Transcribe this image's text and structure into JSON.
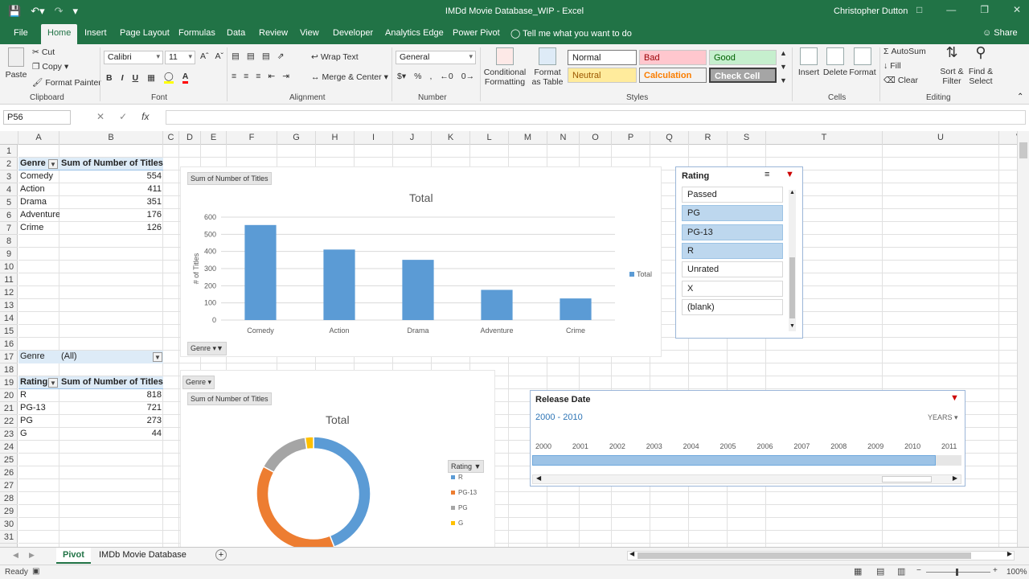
{
  "title": {
    "document": "IMDd Movie Database_WIP - Excel",
    "user": "Christopher Dutton"
  },
  "tabs": [
    "File",
    "Home",
    "Insert",
    "Page Layout",
    "Formulas",
    "Data",
    "Review",
    "View",
    "Developer",
    "Analytics Edge",
    "Power Pivot"
  ],
  "tell_me": "Tell me what you want to do",
  "share": "Share",
  "ribbon": {
    "clipboard": {
      "label": "Clipboard",
      "paste": "Paste",
      "cut": "Cut",
      "copy": "Copy",
      "format_painter": "Format Painter"
    },
    "font": {
      "label": "Font",
      "name": "Calibri",
      "size": "11"
    },
    "alignment": {
      "label": "Alignment",
      "wrap": "Wrap Text",
      "merge": "Merge & Center"
    },
    "number": {
      "label": "Number",
      "format": "General"
    },
    "styles": {
      "label": "Styles",
      "conditional": "Conditional Formatting",
      "format_table": "Format as Table",
      "normal": "Normal",
      "bad": "Bad",
      "good": "Good",
      "neutral": "Neutral",
      "calculation": "Calculation",
      "check_cell": "Check Cell"
    },
    "cells": {
      "label": "Cells",
      "insert": "Insert",
      "delete": "Delete",
      "format": "Format"
    },
    "editing": {
      "label": "Editing",
      "autosum": "AutoSum",
      "fill": "Fill",
      "clear": "Clear",
      "sort": "Sort & Filter",
      "find": "Find & Select"
    }
  },
  "formula_bar": {
    "name_box": "P56",
    "formula": ""
  },
  "columns": [
    "A",
    "B",
    "C",
    "D",
    "E",
    "F",
    "G",
    "H",
    "I",
    "J",
    "K",
    "L",
    "M",
    "N",
    "O",
    "P",
    "Q",
    "R",
    "S",
    "T",
    "U",
    "V"
  ],
  "rows": [
    "1",
    "2",
    "3",
    "4",
    "5",
    "6",
    "7",
    "8",
    "9",
    "10",
    "11",
    "12",
    "13",
    "14",
    "15",
    "16",
    "17",
    "18",
    "19",
    "20",
    "21",
    "22",
    "23",
    "24",
    "25",
    "26",
    "27",
    "28",
    "29",
    "30",
    "31"
  ],
  "pivot1": {
    "headers": [
      "Genre",
      "Sum of Number of Titles"
    ],
    "rows": [
      {
        "label": "Comedy",
        "value": "554"
      },
      {
        "label": "Action",
        "value": "411"
      },
      {
        "label": "Drama",
        "value": "351"
      },
      {
        "label": "Adventure",
        "value": "176"
      },
      {
        "label": "Crime",
        "value": "126"
      }
    ]
  },
  "pivot2": {
    "filter_label": "Genre",
    "filter_value": "(All)",
    "headers": [
      "Rating",
      "Sum of Number of Titles"
    ],
    "rows": [
      {
        "label": "R",
        "value": "818"
      },
      {
        "label": "PG-13",
        "value": "721"
      },
      {
        "label": "PG",
        "value": "273"
      },
      {
        "label": "G",
        "value": "44"
      }
    ]
  },
  "chart_data": [
    {
      "type": "bar",
      "field_button": "Sum of Number of Titles",
      "axis_button": "Genre",
      "title": "Total",
      "ylabel": "# of Titles",
      "xlabel": "",
      "categories": [
        "Comedy",
        "Action",
        "Drama",
        "Adventure",
        "Crime"
      ],
      "series": [
        {
          "name": "Total",
          "values": [
            554,
            411,
            351,
            176,
            126
          ],
          "color": "#5b9bd5"
        }
      ],
      "ylim": [
        0,
        600
      ],
      "yticks": [
        0,
        100,
        200,
        300,
        400,
        500,
        600
      ],
      "grid": true,
      "legend": "right"
    },
    {
      "type": "pie",
      "style": "doughnut",
      "report_filter_button": "Genre",
      "field_button": "Sum of Number of Titles",
      "title": "Total",
      "legend_title": "Rating",
      "categories": [
        "R",
        "PG-13",
        "PG",
        "G"
      ],
      "values": [
        818,
        721,
        273,
        44
      ],
      "colors": [
        "#5b9bd5",
        "#ed7d31",
        "#a5a5a5",
        "#ffc000"
      ],
      "legend": "right"
    }
  ],
  "slicer": {
    "title": "Rating",
    "items": [
      {
        "label": "Passed",
        "selected": false
      },
      {
        "label": "PG",
        "selected": true
      },
      {
        "label": "PG-13",
        "selected": true
      },
      {
        "label": "R",
        "selected": true
      },
      {
        "label": "Unrated",
        "selected": false
      },
      {
        "label": "X",
        "selected": false
      },
      {
        "label": "(blank)",
        "selected": false
      }
    ]
  },
  "timeline": {
    "title": "Release Date",
    "range": "2000 - 2010",
    "level": "YEARS",
    "years": [
      "2000",
      "2001",
      "2002",
      "2003",
      "2004",
      "2005",
      "2006",
      "2007",
      "2008",
      "2009",
      "2010",
      "2011"
    ]
  },
  "sheets": [
    {
      "name": "Pivot",
      "active": true
    },
    {
      "name": "IMDb Movie Database",
      "active": false
    }
  ],
  "status": {
    "ready": "Ready",
    "zoom": "100%"
  },
  "colors": {
    "excel_green": "#217346",
    "pivot_header": "#ddebf7",
    "slicer_selected": "#bdd7ee"
  }
}
